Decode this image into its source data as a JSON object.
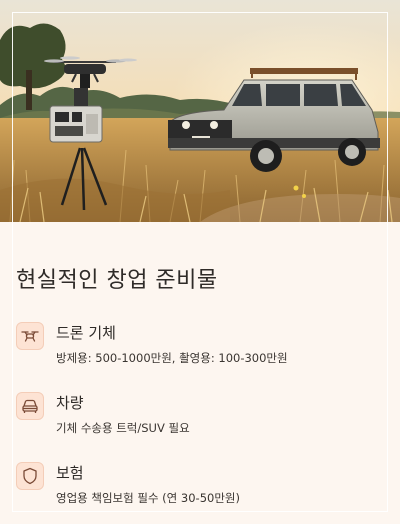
{
  "hero": {
    "alt_description": "",
    "plate_text": "",
    "colors": {
      "sky": "#f3d7ad",
      "field": "#c79a52",
      "truck": "#b9b8ae"
    }
  },
  "section_title": "현실적인 창업 준비물",
  "items": [
    {
      "icon": "drone-icon",
      "label": "드론 기체",
      "desc": "방제용: 500-1000만원, 촬영용: 100-300만원"
    },
    {
      "icon": "car-icon",
      "label": "차량",
      "desc": "기체 수송용 트럭/SUV 필요"
    },
    {
      "icon": "shield-icon",
      "label": "보험",
      "desc": "영업용 책임보험 필수 (연 30-50만원)"
    }
  ],
  "accent_color": "#fde3d4"
}
